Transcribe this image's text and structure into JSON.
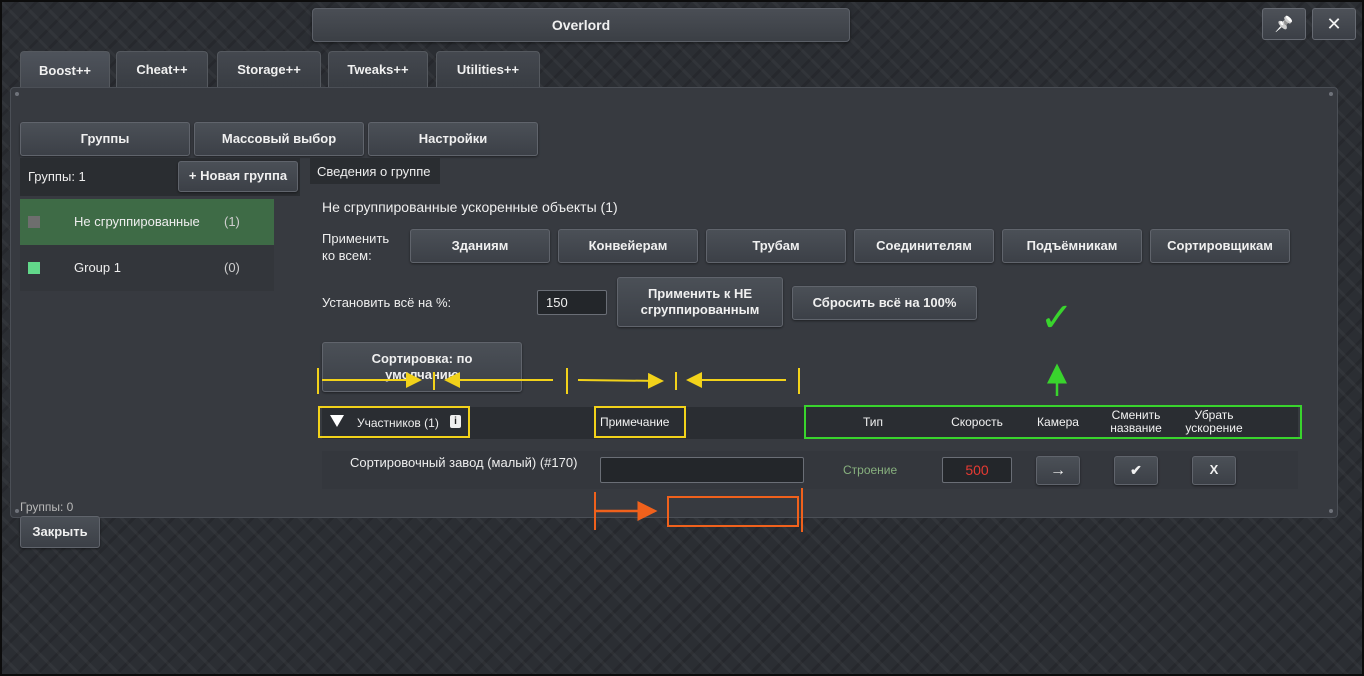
{
  "window": {
    "title": "Overlord",
    "pin_icon": "pin-icon",
    "close_icon": "close-icon",
    "pin_glyph": "📌",
    "close_glyph": "✕"
  },
  "tabs": [
    {
      "label": "Boost++",
      "active": true
    },
    {
      "label": "Cheat++"
    },
    {
      "label": "Storage++"
    },
    {
      "label": "Tweaks++"
    },
    {
      "label": "Utilities++"
    }
  ],
  "subtabs": [
    "Группы",
    "Массовый выбор",
    "Настройки"
  ],
  "sidebar": {
    "groups_count": "Группы: 1",
    "new_group_button": "+ Новая группа",
    "groups": [
      {
        "name": "Не сгруппированные",
        "count": "(1)",
        "color": "#6e6e6e",
        "selected": true
      },
      {
        "name": "Group 1",
        "count": "(0)",
        "color": "#62d88a"
      }
    ],
    "footer_count": "Группы: 0",
    "close_button": "Закрыть"
  },
  "details": {
    "tab_label": "Сведения о группе",
    "heading": "Не сгруппированные ускоренные объекты (1)",
    "apply_all_label": "Применить ко всем:",
    "apply_buttons": [
      "Зданиям",
      "Конвейерам",
      "Трубам",
      "Соединителям",
      "Подъёмникам",
      "Сортировщикам"
    ],
    "set_all_label": "Установить всё на %:",
    "set_all_value": "150",
    "apply_ungrouped_button": "Применить к НЕ сгруппированным",
    "reset_button": "Сбросить всё на 100%",
    "sort_button": "Сортировка: по умолчанию"
  },
  "table": {
    "members_header": "Участников (1)",
    "note_header": "Примечание",
    "columns": [
      "Тип",
      "Скорость",
      "Камера",
      "Сменить название",
      "Убрать ускорение"
    ],
    "rows": [
      {
        "name": "Сортировочный завод (малый) (#170)",
        "note": "",
        "type": "Строение",
        "speed": "500",
        "camera_glyph": "→",
        "rename_glyph": "✔",
        "remove_glyph": "X"
      }
    ]
  },
  "annotations": {
    "check_glyph": "✓",
    "colors": {
      "yellow": "#f2d21a",
      "green": "#39d42d",
      "orange": "#f0611c"
    }
  }
}
